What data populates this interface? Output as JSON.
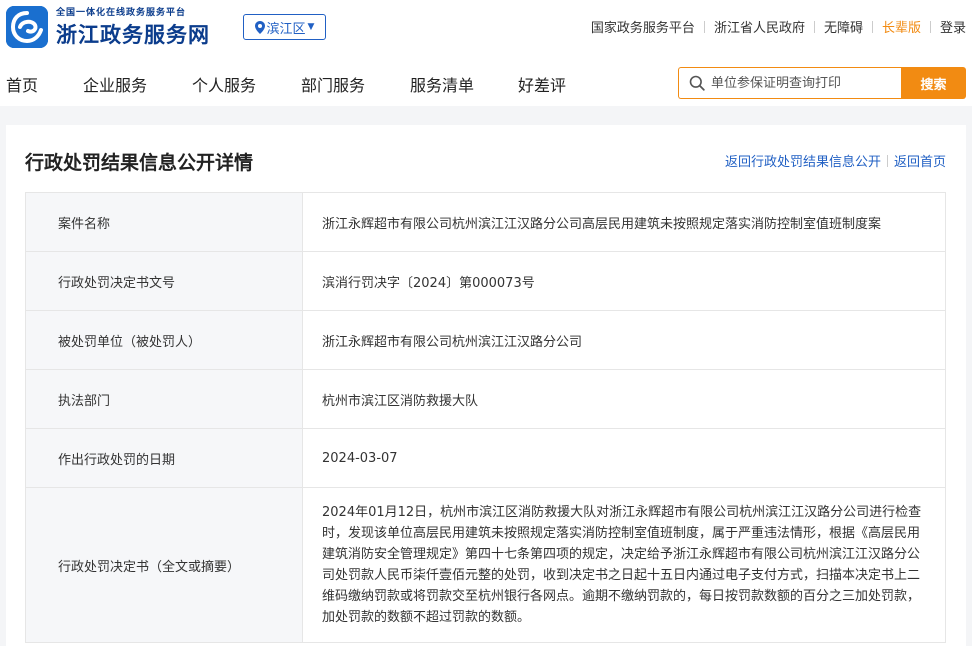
{
  "header": {
    "brand_sub": "全国一体化在线政务服务平台",
    "brand_title": "浙江政务服务网",
    "region": "滨江区",
    "top_links": [
      {
        "label": "国家政务服务平台"
      },
      {
        "label": "浙江省人民政府"
      },
      {
        "label": "无障碍"
      },
      {
        "label": "长辈版",
        "highlight": true
      },
      {
        "label": "登录"
      }
    ]
  },
  "nav": {
    "items": [
      "首页",
      "企业服务",
      "个人服务",
      "部门服务",
      "服务清单",
      "好差评"
    ]
  },
  "search": {
    "placeholder": "单位参保证明查询打印",
    "button": "搜索"
  },
  "page": {
    "title": "行政处罚结果信息公开详情",
    "back_link": "返回行政处罚结果信息公开",
    "home_link": "返回首页"
  },
  "details": [
    {
      "label": "案件名称",
      "value": "浙江永辉超市有限公司杭州滨江江汉路分公司高层民用建筑未按照规定落实消防控制室值班制度案"
    },
    {
      "label": "行政处罚决定书文号",
      "value": "滨消行罚决字〔2024〕第000073号"
    },
    {
      "label": "被处罚单位（被处罚人）",
      "value": "浙江永辉超市有限公司杭州滨江江汉路分公司"
    },
    {
      "label": "执法部门",
      "value": "杭州市滨江区消防救援大队"
    },
    {
      "label": "作出行政处罚的日期",
      "value": "2024-03-07"
    },
    {
      "label": "行政处罚决定书（全文或摘要）",
      "value": "2024年01月12日，杭州市滨江区消防救援大队对浙江永辉超市有限公司杭州滨江江汉路分公司进行检查时，发现该单位高层民用建筑未按照规定落实消防控制室值班制度，属于严重违法情形，根据《高层民用建筑消防安全管理规定》第四十七条第四项的规定，决定给予浙江永辉超市有限公司杭州滨江江汉路分公司处罚款人民币柒仟壹佰元整的处罚，收到决定书之日起十五日内通过电子支付方式，扫描本决定书上二维码缴纳罚款或将罚款交至杭州银行各网点。逾期不缴纳罚款的，每日按罚款数额的百分之三加处罚款，加处罚款的数额不超过罚款的数额。"
    }
  ],
  "colors": {
    "brand_blue": "#0b3c8c",
    "link_blue": "#2160c4",
    "accent_orange": "#f28b12"
  }
}
